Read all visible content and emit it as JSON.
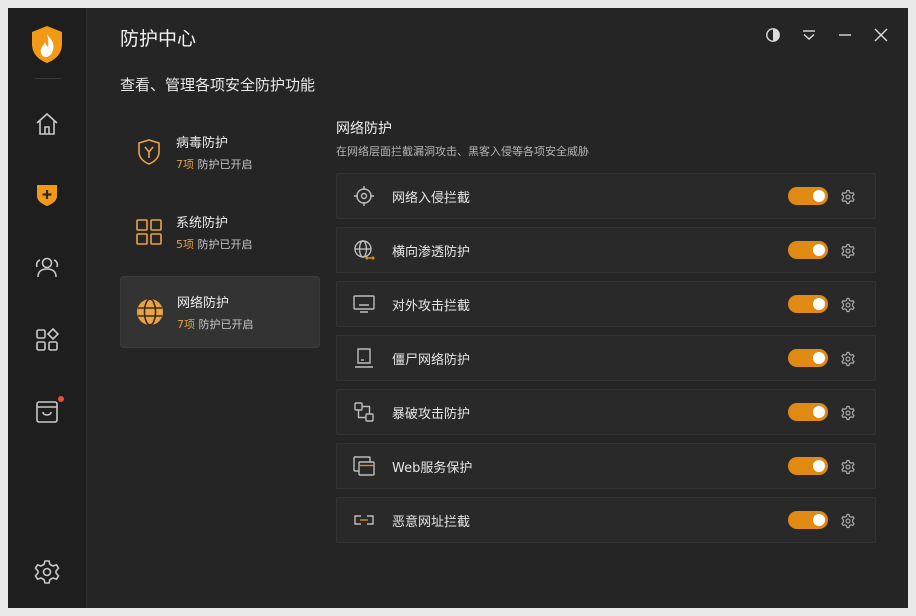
{
  "window": {
    "title": "防护中心",
    "subtitle": "查看、管理各项安全防护功能"
  },
  "sidebar": {
    "items": [
      {
        "name": "home-icon"
      },
      {
        "name": "protection-icon",
        "active": true
      },
      {
        "name": "users-icon"
      },
      {
        "name": "apps-icon"
      },
      {
        "name": "store-icon",
        "badge": true
      },
      {
        "name": "settings-icon"
      }
    ]
  },
  "categories": [
    {
      "name": "病毒防护",
      "count": "7项",
      "status": "防护已开启",
      "icon": "virus-shield-icon",
      "active": false
    },
    {
      "name": "系统防护",
      "count": "5项",
      "status": "防护已开启",
      "icon": "system-grid-icon",
      "active": false
    },
    {
      "name": "网络防护",
      "count": "7项",
      "status": "防护已开启",
      "icon": "network-globe-icon",
      "active": true
    }
  ],
  "panel": {
    "title": "网络防护",
    "description": "在网络层面拦截漏洞攻击、黑客入侵等各项安全威胁",
    "items": [
      {
        "label": "网络入侵拦截",
        "icon": "target-icon",
        "enabled": true
      },
      {
        "label": "横向渗透防护",
        "icon": "globe-arrow-icon",
        "enabled": true
      },
      {
        "label": "对外攻击拦截",
        "icon": "monitor-icon",
        "enabled": true
      },
      {
        "label": "僵尸网络防护",
        "icon": "device-icon",
        "enabled": true
      },
      {
        "label": "暴破攻击防护",
        "icon": "nodes-icon",
        "enabled": true
      },
      {
        "label": "Web服务保护",
        "icon": "windows-icon",
        "enabled": true
      },
      {
        "label": "恶意网址拦截",
        "icon": "link-icon",
        "enabled": true
      }
    ]
  },
  "colors": {
    "accent": "#e08a14",
    "count": "#e0a048",
    "background": "#252525",
    "sidebar": "#1e1e1e"
  }
}
